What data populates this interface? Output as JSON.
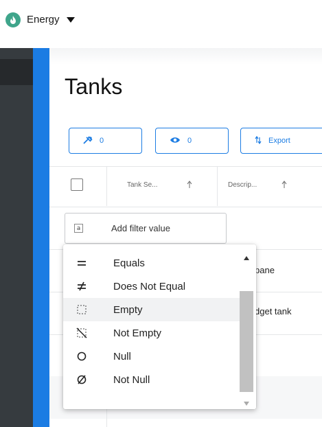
{
  "app": {
    "title": "Energy",
    "logo_icon": "flame-icon",
    "accent": "#3fa58b"
  },
  "page": {
    "title": "Tanks"
  },
  "toolbar": {
    "pin_count": "0",
    "visible_count": "0",
    "export_label": "Export"
  },
  "table": {
    "columns": [
      {
        "label": "Tank Se...",
        "sort": "ascending"
      },
      {
        "label": "Descrip...",
        "sort": "ascending"
      }
    ],
    "filter": {
      "type_icon": "a",
      "placeholder": "Add filter value"
    },
    "rows": [
      {
        "description": "…pane"
      },
      {
        "description": "…dget tank"
      }
    ]
  },
  "dropdown": {
    "options": [
      {
        "label": "Equals",
        "icon": "equals-icon",
        "glyph": "="
      },
      {
        "label": "Does Not Equal",
        "icon": "not-equal-icon",
        "glyph": "≠"
      },
      {
        "label": "Empty",
        "icon": "empty-icon",
        "glyph": ""
      },
      {
        "label": "Not Empty",
        "icon": "not-empty-icon",
        "glyph": ""
      },
      {
        "label": "Null",
        "icon": "null-icon",
        "glyph": "○"
      },
      {
        "label": "Not Null",
        "icon": "not-null-icon",
        "glyph": "⌀"
      }
    ],
    "highlighted": "Empty"
  },
  "colors": {
    "primary": "#1b7ce3",
    "rail": "#363b3f"
  }
}
